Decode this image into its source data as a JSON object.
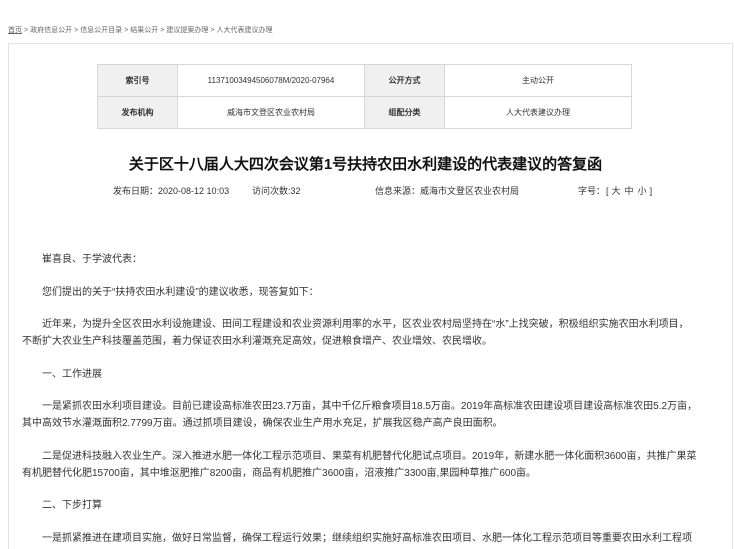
{
  "colors": {
    "text": "#333333",
    "crumb": "#666666",
    "title": "#111111",
    "border": "#e2e2e2",
    "grid": "#d7d7d7",
    "label_bg": "#f0f0f0"
  },
  "breadcrumb": {
    "items": [
      "首页",
      "政府信息公开",
      "信息公开目录",
      "结果公开",
      "建议提案办理",
      "人大代表建议办理"
    ],
    "separator": ">"
  },
  "info_table": {
    "index_no_label": "索引号",
    "index_no": "11371003494506078M/2020-07964",
    "disclosure_label": "公开方式",
    "disclosure": "主动公开",
    "publisher_label": "发布机构",
    "publisher": "威海市文登区农业农村局",
    "category_label": "组配分类",
    "category": "人大代表建议办理"
  },
  "article": {
    "title": "关于区十八届人大四次会议第1号扶持农田水利建设的代表建议的答复函",
    "meta": {
      "publish_date_label": "发布日期：",
      "publish_date": "2020-08-12 10:03",
      "views_label": "访问次数:",
      "views": "32",
      "source_label": "信息来源：",
      "source": "威海市文登区农业农村局",
      "font_size_label": "字号：",
      "font_size_open": "[",
      "font_size_options": [
        "大",
        "中",
        "小"
      ],
      "font_size_close": "]"
    },
    "paragraphs": [
      {
        "lines": [
          "崔喜良、于学波代表："
        ]
      },
      {
        "lines": [
          "您们提出的关于“扶持农田水利建设”的建议收悉，现答复如下："
        ]
      },
      {
        "lines": [
          "近年来，为提升全区农田水利设施建设、田间工程建设和农业资源利用率的水平，区农业农村局坚持在“水”上找突破，积极组织实施农田水利项目，",
          "不断扩大农业生产科技覆盖范围，着力保证农田水利灌溉充足高效，促进粮食增产、农业增效、农民增收。"
        ]
      },
      {
        "lines": [
          "一、工作进展"
        ]
      },
      {
        "lines": [
          "一是紧抓农田水利项目建设。目前已建设高标准农田23.7万亩，其中千亿斤粮食项目18.5万亩。2019年高标准农田建设项目建设高标准农田5.2万亩，",
          "其中高效节水灌溉面积2.7799万亩。通过抓项目建设，确保农业生产用水充足，扩展我区稳产高产良田面积。"
        ]
      },
      {
        "lines": [
          "二是促进科技融入农业生产。深入推进水肥一体化工程示范项目、果菜有机肥替代化肥试点项目。2019年，新建水肥一体化面积3600亩，共推广果菜",
          "有机肥替代化肥15700亩，其中堆沤肥推广8200亩，商品有机肥推广3600亩，沼液推广3300亩,果园种草推广600亩。"
        ]
      },
      {
        "lines": [
          "二、下步打算"
        ]
      },
      {
        "lines": [
          "一是抓紧推进在建项目实施，做好日常监督，确保工程运行效果；继续组织实施好高标准农田项目、水肥一体化工程示范项目等重要农田水利工程项"
        ]
      }
    ]
  }
}
